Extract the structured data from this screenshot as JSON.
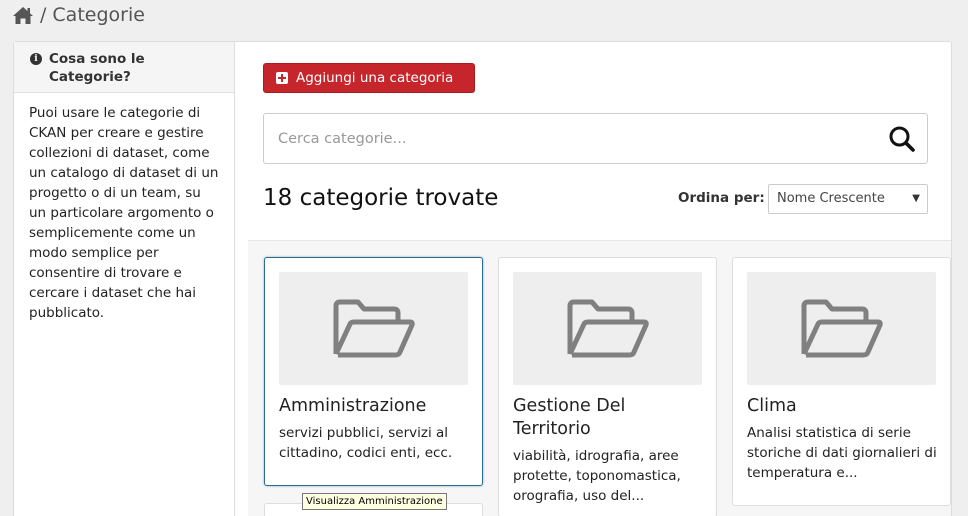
{
  "breadcrumb": {
    "home_icon": "home-icon",
    "separator": "/",
    "current": "Categorie"
  },
  "sidebar": {
    "info_icon": "info-icon",
    "heading": "Cosa sono le Categorie?",
    "text": "Puoi usare le categorie di CKAN per creare e gestire collezioni di dataset, come un catalogo di dataset di un progetto o di un team, su un particolare argomento o semplicemente come un modo semplice per consentire di trovare e cercare i dataset che hai pubblicato."
  },
  "toolbar": {
    "add_label": "Aggiungi una categoria",
    "add_icon": "plus-square-icon",
    "accent_color": "#c6262b"
  },
  "search": {
    "placeholder": "Cerca categorie...",
    "value": "",
    "icon": "search-icon"
  },
  "results": {
    "count_text": "18 categorie trovate"
  },
  "sort": {
    "label": "Ordina per:",
    "selected": "Nome Crescente"
  },
  "categories": [
    {
      "title": "Amministrazione",
      "description": "servizi pubblici, servizi al cittadino, codici enti, ecc.",
      "icon": "folder-open-icon"
    },
    {
      "title": "Gestione Del Territorio",
      "description": "viabilità, idrografia, aree protette, toponomastica, orografia, uso del...",
      "icon": "folder-open-icon"
    },
    {
      "title": "Clima",
      "description": "Analisi statistica di serie storiche di dati giornalieri di temperatura e...",
      "icon": "folder-open-icon"
    }
  ],
  "tooltip": {
    "text": "Visualizza Amministrazione"
  }
}
